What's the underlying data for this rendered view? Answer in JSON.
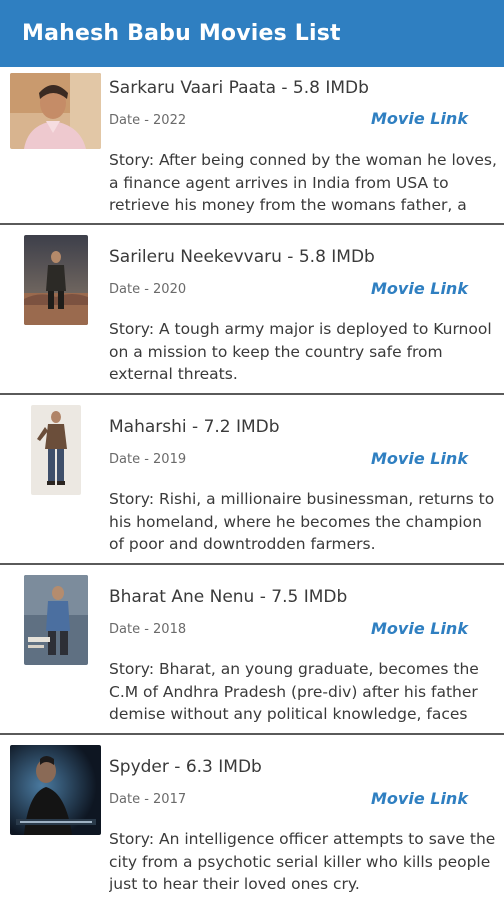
{
  "app_bar": {
    "title": "Mahesh Babu Movies List",
    "color": "#2f7fc1"
  },
  "link_color": "#2f7fc1",
  "movies": [
    {
      "title": "Sarkaru Vaari Paata - 5.8 IMDb",
      "date": "Date - 2022",
      "link_label": "Movie Link",
      "story": "Story: After being conned by the woman he loves, a finance agent arrives in India from USA to retrieve his money from the womans father, a"
    },
    {
      "title": "Sarileru Neekevvaru - 5.8 IMDb",
      "date": "Date - 2020",
      "link_label": "Movie Link",
      "story": "Story: A tough army major is deployed to Kurnool on a mission to keep the country safe from external threats."
    },
    {
      "title": "Maharshi - 7.2 IMDb",
      "date": "Date - 2019",
      "link_label": "Movie Link",
      "story": "Story: Rishi, a millionaire businessman, returns to his homeland, where he becomes the champion of poor and downtrodden farmers."
    },
    {
      "title": "Bharat Ane Nenu - 7.5 IMDb",
      "date": "Date - 2018",
      "link_label": "Movie Link",
      "story": "Story: Bharat, an young graduate, becomes the C.M of Andhra Pradesh (pre-div) after his father demise without any political knowledge, faces"
    },
    {
      "title": "Spyder - 6.3 IMDb",
      "date": "Date - 2017",
      "link_label": "Movie Link",
      "story": "Story: An intelligence officer attempts to save the city from a psychotic serial killer who kills people just to hear their loved ones cry."
    }
  ]
}
